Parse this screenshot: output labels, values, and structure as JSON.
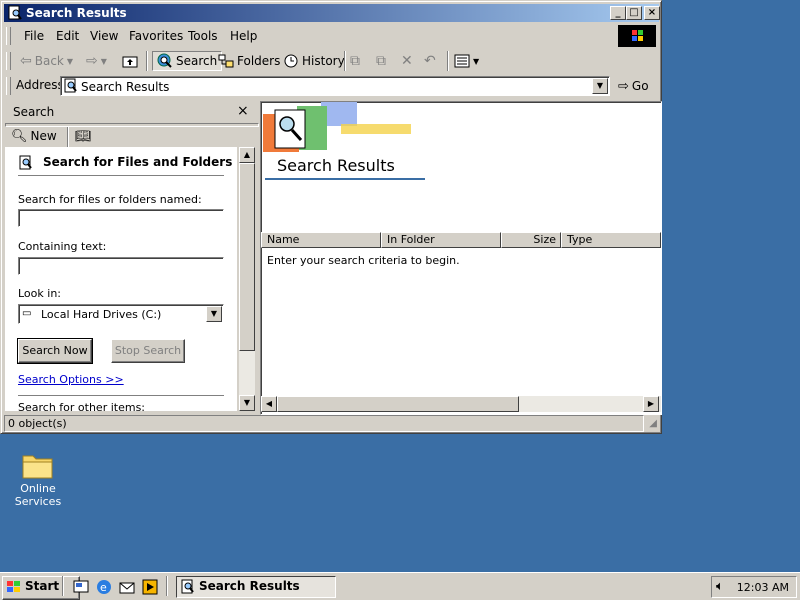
{
  "window": {
    "title": "Search Results",
    "caption_buttons": {
      "minimize": "_",
      "maximize": "□",
      "close": "×"
    }
  },
  "menu": {
    "items": [
      {
        "label": "File"
      },
      {
        "label": "Edit"
      },
      {
        "label": "View"
      },
      {
        "label": "Favorites"
      },
      {
        "label": "Tools"
      },
      {
        "label": "Help"
      }
    ]
  },
  "toolbar": {
    "back_label": "Back",
    "search_label": "Search",
    "folders_label": "Folders",
    "history_label": "History"
  },
  "address": {
    "label": "Address",
    "value": "Search Results",
    "go_label": "Go"
  },
  "search_pane": {
    "title": "Search",
    "new_label": "New",
    "heading": "Search for Files and Folders",
    "name_label": "Search for files or folders named:",
    "name_value": "",
    "containing_label": "Containing text:",
    "containing_value": "",
    "look_in_label": "Look in:",
    "look_in_value": "Local Hard Drives (C:)",
    "search_now_label": "Search Now",
    "stop_search_label": "Stop Search",
    "options_link": "Search Options >>",
    "other_items": "Search for other items:"
  },
  "results": {
    "title": "Search Results",
    "columns": [
      "Name",
      "In Folder",
      "Size",
      "Type"
    ],
    "empty_message": "Enter your search criteria to begin."
  },
  "status": {
    "text": "0 object(s)"
  },
  "desktop": {
    "icons": [
      {
        "label_line1": "Online",
        "label_line2": "Services"
      }
    ]
  },
  "taskbar": {
    "start_label": "Start",
    "task_label": "Search Results",
    "clock": "12:03 AM"
  },
  "colors": {
    "desktop": "#3a6ea5",
    "titlebar_start": "#0a246a",
    "titlebar_end": "#a6caf0",
    "face": "#d4d0c8",
    "link": "#0000cc"
  }
}
